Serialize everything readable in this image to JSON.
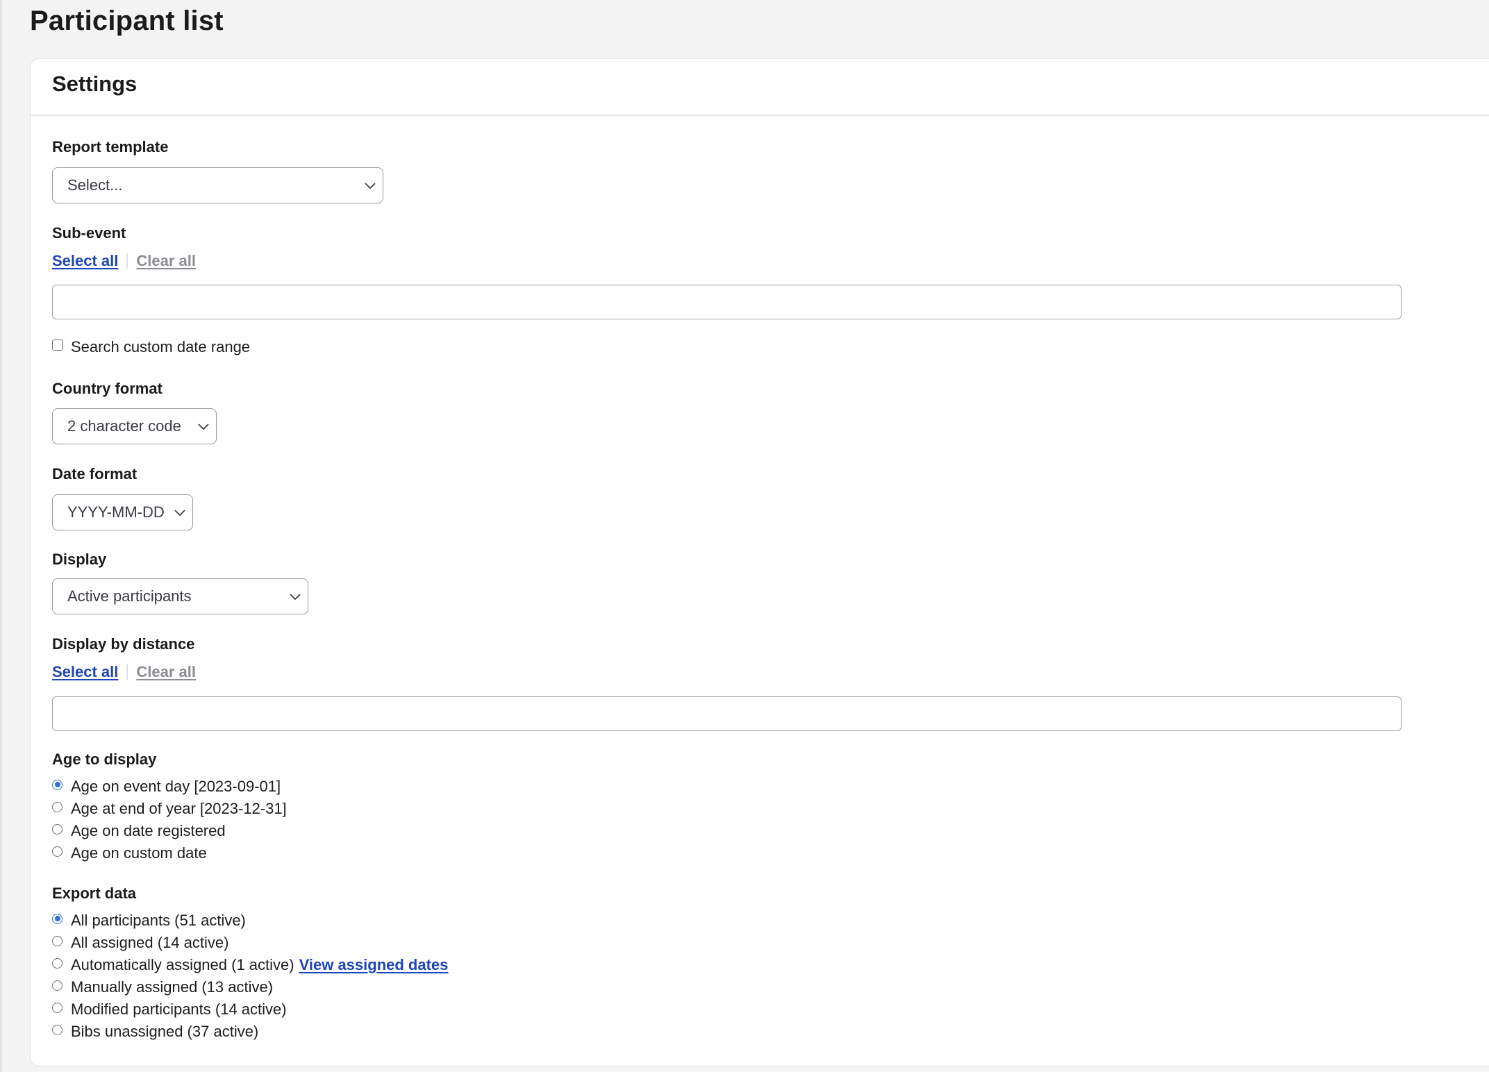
{
  "page": {
    "title": "Participant list"
  },
  "settings": {
    "title": "Settings",
    "report_template": {
      "label": "Report template",
      "value": "Select..."
    },
    "sub_event": {
      "label": "Sub-event",
      "select_all": "Select all",
      "clear_all": "Clear all",
      "value": ""
    },
    "custom_date_range": {
      "label": "Search custom date range",
      "checked": false
    },
    "country_format": {
      "label": "Country format",
      "value": "2 character code"
    },
    "date_format": {
      "label": "Date format",
      "value": "YYYY-MM-DD"
    },
    "display": {
      "label": "Display",
      "value": "Active participants"
    },
    "display_by_distance": {
      "label": "Display by distance",
      "select_all": "Select all",
      "clear_all": "Clear all",
      "value": ""
    },
    "age_to_display": {
      "label": "Age to display",
      "options": [
        {
          "label": "Age on event day [2023-09-01]",
          "checked": true
        },
        {
          "label": "Age at end of year [2023-12-31]",
          "checked": false
        },
        {
          "label": "Age on date registered",
          "checked": false
        },
        {
          "label": "Age on custom date",
          "checked": false
        }
      ]
    },
    "export_data": {
      "label": "Export data",
      "options": [
        {
          "label": "All participants (51 active)",
          "checked": true
        },
        {
          "label": "All assigned (14 active)",
          "checked": false
        },
        {
          "label": "Automatically assigned (1 active)",
          "checked": false,
          "link": "View assigned dates"
        },
        {
          "label": "Manually assigned (13 active)",
          "checked": false
        },
        {
          "label": "Modified participants (14 active)",
          "checked": false
        },
        {
          "label": "Bibs unassigned (37 active)",
          "checked": false
        }
      ]
    }
  },
  "colors": {
    "link": "#1e45b8",
    "link_disabled": "#8c8c94",
    "radio_checked": "#2f6fe6",
    "background": "#f4f4f4"
  }
}
